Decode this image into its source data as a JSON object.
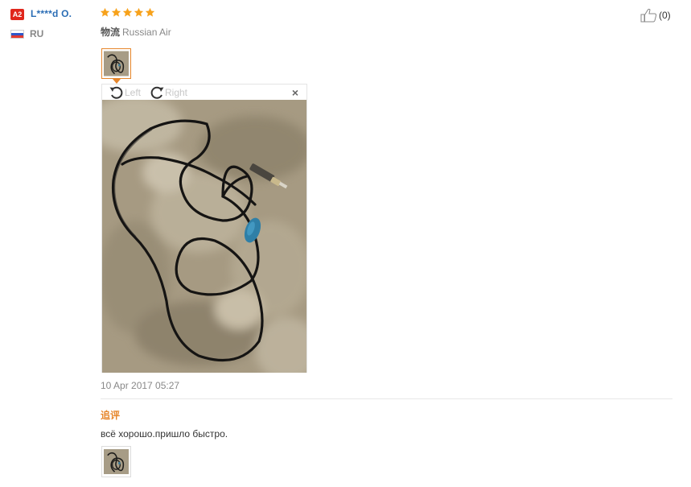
{
  "user": {
    "level_badge": "A2",
    "name": "L****d O.",
    "country_code": "RU",
    "flag_colors": [
      "#ffffff",
      "#2f57c8",
      "#e23b2e"
    ]
  },
  "review": {
    "rating": 5,
    "rating_max": 5,
    "star_color": "#f7a21b",
    "logistics_label": "物流",
    "logistics_value": "Russian Air",
    "date": "10 Apr 2017 05:27",
    "helpful_count": "(0)"
  },
  "viewer": {
    "rotate_left_label": "Left",
    "rotate_right_label": "Right",
    "close_icon": "×"
  },
  "followup": {
    "label": "追评",
    "text": "всё хорошо.пришло быстро."
  },
  "colors": {
    "accent_orange": "#e6862b",
    "username_blue": "#2a6db5",
    "badge_red": "#e0261c"
  },
  "icons": {
    "star": "star-icon",
    "thumbs_up": "thumbs-up-icon",
    "rotate_left": "rotate-left-icon",
    "rotate_right": "rotate-right-icon",
    "close": "close-icon"
  }
}
